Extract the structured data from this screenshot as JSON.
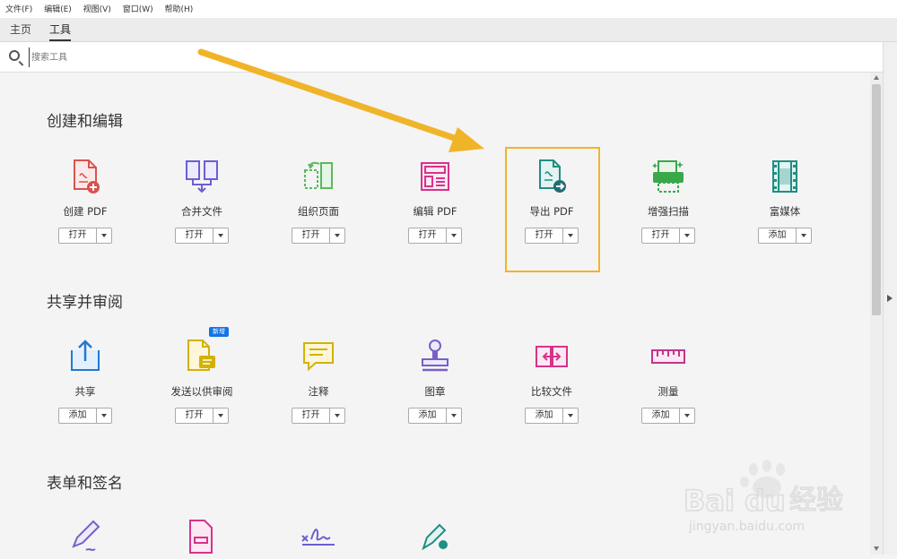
{
  "menu": [
    "文件(F)",
    "编辑(E)",
    "视图(V)",
    "窗口(W)",
    "帮助(H)"
  ],
  "tabs": [
    "主页",
    "工具"
  ],
  "search": {
    "placeholder": "搜索工具"
  },
  "sections": [
    {
      "title": "创建和编辑",
      "tools": [
        {
          "label": "创建 PDF",
          "button": "打开",
          "icon": "create-pdf-icon"
        },
        {
          "label": "合并文件",
          "button": "打开",
          "icon": "combine-files-icon"
        },
        {
          "label": "组织页面",
          "button": "打开",
          "icon": "organize-pages-icon"
        },
        {
          "label": "编辑 PDF",
          "button": "打开",
          "icon": "edit-pdf-icon"
        },
        {
          "label": "导出 PDF",
          "button": "打开",
          "icon": "export-pdf-icon"
        },
        {
          "label": "增强扫描",
          "button": "打开",
          "icon": "enhance-scan-icon"
        },
        {
          "label": "富媒体",
          "button": "添加",
          "icon": "rich-media-icon"
        }
      ]
    },
    {
      "title": "共享并审阅",
      "tools": [
        {
          "label": "共享",
          "button": "添加",
          "icon": "share-icon"
        },
        {
          "label": "发送以供审阅",
          "button": "打开",
          "icon": "send-review-icon",
          "badge": "新增"
        },
        {
          "label": "注释",
          "button": "打开",
          "icon": "comment-icon"
        },
        {
          "label": "图章",
          "button": "添加",
          "icon": "stamp-icon"
        },
        {
          "label": "比较文件",
          "button": "添加",
          "icon": "compare-files-icon"
        },
        {
          "label": "测量",
          "button": "添加",
          "icon": "measure-icon"
        }
      ]
    },
    {
      "title": "表单和签名",
      "tools": [
        {
          "icon": "fill-sign-icon"
        },
        {
          "icon": "prepare-form-icon"
        },
        {
          "icon": "signature-icon"
        },
        {
          "icon": "certificate-icon"
        }
      ]
    }
  ],
  "watermark": {
    "brand": "Bai",
    "brand2": "du",
    "cn": "经验",
    "url": "jingyan.baidu.com"
  },
  "colors": {
    "highlight": "#f0b429",
    "arrow": "#f0b429"
  }
}
